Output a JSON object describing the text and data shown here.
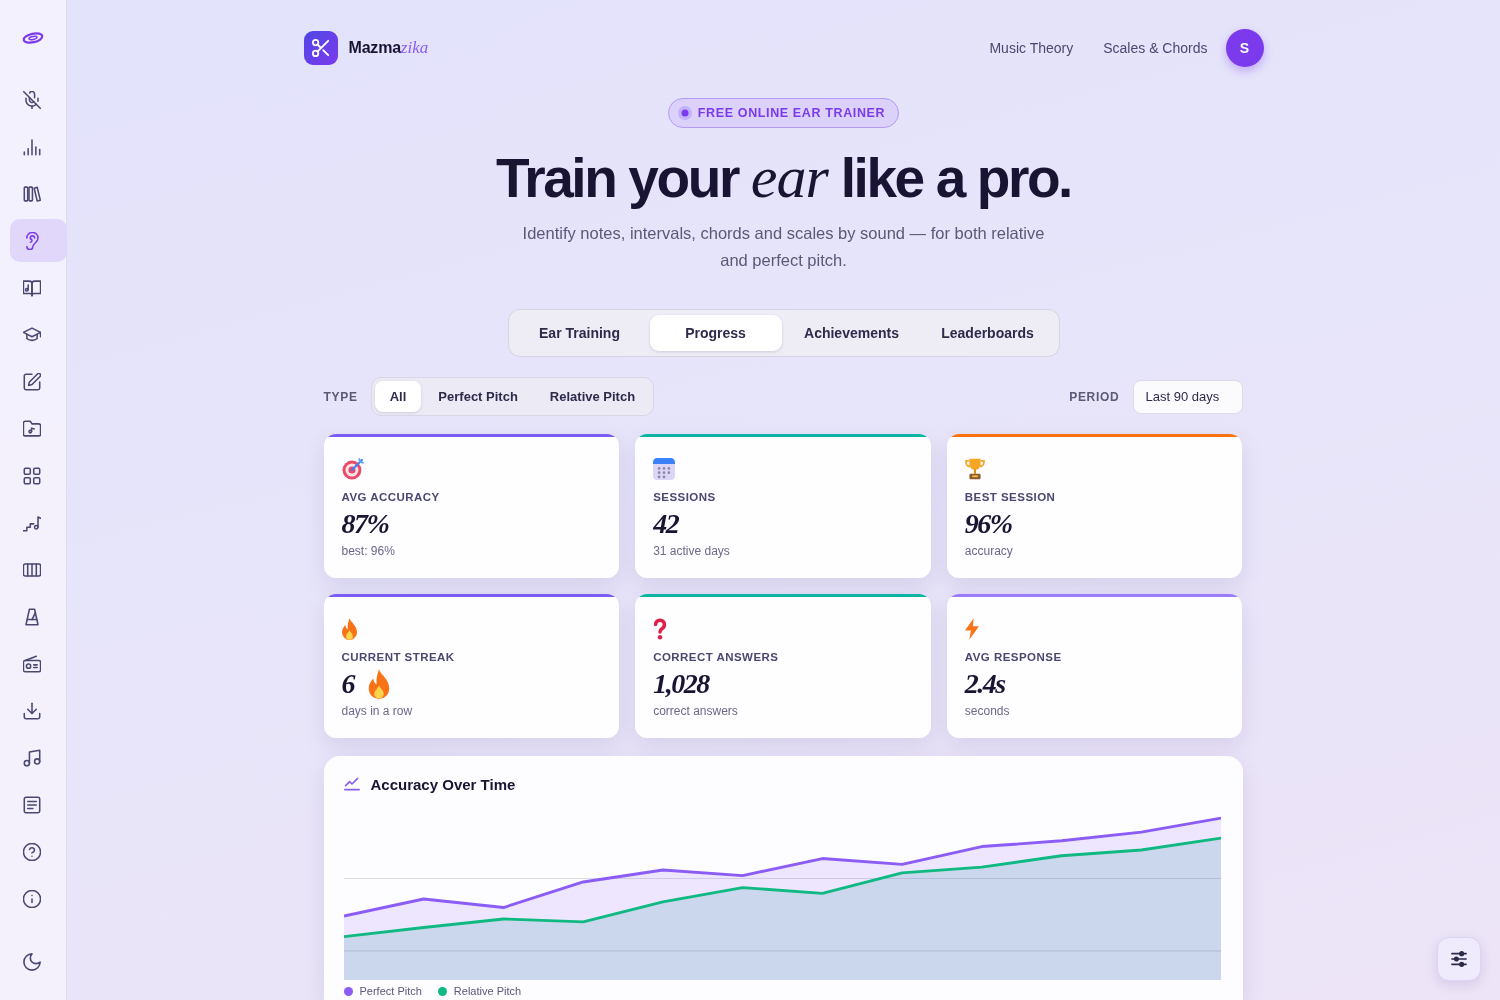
{
  "sidebar": {
    "items": [
      {
        "selected": false
      },
      {
        "selected": false
      },
      {
        "selected": false
      },
      {
        "selected": true
      },
      {
        "selected": false
      },
      {
        "selected": false
      },
      {
        "selected": false
      },
      {
        "selected": false
      },
      {
        "selected": false
      },
      {
        "selected": false
      },
      {
        "selected": false
      },
      {
        "selected": false
      },
      {
        "selected": false
      },
      {
        "selected": false
      },
      {
        "selected": false
      },
      {
        "selected": false
      },
      {
        "selected": false
      },
      {
        "selected": false
      }
    ]
  },
  "header": {
    "brand": {
      "name": "Mazma",
      "accent": "zika"
    },
    "nav_links": [
      "Music Theory",
      "Scales & Chords"
    ],
    "avatar": "S"
  },
  "hero": {
    "badge": "FREE ONLINE EAR TRAINER",
    "title": "Train your *ear* like a pro.",
    "subtitle": "Identify notes, intervals, chords and scales by sound — for both relative and perfect pitch."
  },
  "tabs": [
    {
      "label": "Ear Training",
      "selected": false
    },
    {
      "label": "Progress",
      "selected": true
    },
    {
      "label": "Achievements",
      "selected": false
    },
    {
      "label": "Leaderboards",
      "selected": false
    }
  ],
  "filters": {
    "type_label": "TYPE",
    "type_options": [
      {
        "label": "All",
        "selected": true
      },
      {
        "label": "Perfect Pitch",
        "selected": false
      },
      {
        "label": "Relative Pitch",
        "selected": false
      }
    ],
    "period_label": "PERIOD",
    "period_value": "Last 90 days"
  },
  "stats": [
    {
      "kind": "stat",
      "label": "AVG ACCURACY",
      "value": "87%",
      "note": "best: 96%",
      "color": "#7c5cf6"
    },
    {
      "kind": "stat",
      "label": "SESSIONS",
      "value": "42",
      "note": "31 active days",
      "color": "#0db4a4"
    },
    {
      "kind": "stat",
      "label": "BEST SESSION",
      "value": "96%",
      "note": "accuracy",
      "color": "#f97316"
    },
    {
      "kind": "streak",
      "label": "CURRENT STREAK",
      "value": "6",
      "note": "days in a row",
      "color": "#7c5cf6"
    },
    {
      "kind": "stat",
      "label": "CORRECT ANSWERS",
      "value": "1,028",
      "note": "correct answers",
      "color": "#0db4a4"
    },
    {
      "kind": "stat",
      "label": "AVG RESPONSE",
      "value": "2.4s",
      "note": "seconds",
      "color": "#9b7cf8"
    }
  ],
  "chart": {
    "title": "Accuracy Over Time",
    "legend": [
      {
        "label": "Perfect Pitch",
        "color": "#8b5cf6"
      },
      {
        "label": "Relative Pitch",
        "color": "#10b981"
      }
    ]
  }
}
